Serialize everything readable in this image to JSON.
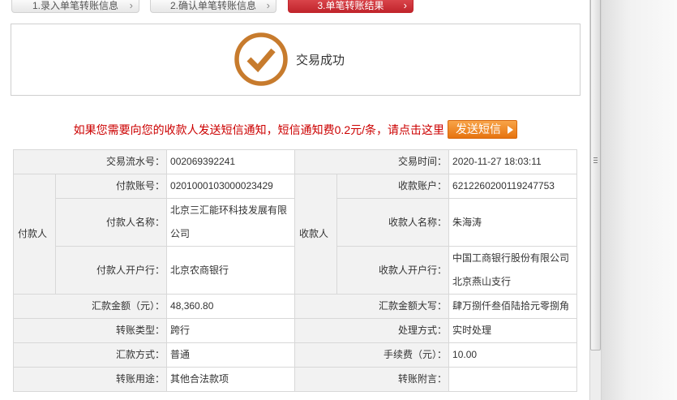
{
  "colors": {
    "active_step_bg": "#c1252c",
    "active_step_bg_light": "#d9444a",
    "success_icon": "#c77b2d",
    "notice_text": "#cc0000",
    "sms_button": "#e6730f"
  },
  "steps": [
    {
      "label": "1.录入单笔转账信息",
      "icon": "chevron-right-icon",
      "active": false
    },
    {
      "label": "2.确认单笔转账信息",
      "icon": "chevron-right-icon",
      "active": false
    },
    {
      "label": "3.单笔转账结果",
      "icon": "chevron-right-icon",
      "active": true
    }
  ],
  "result": {
    "icon": "check-circle-icon",
    "status_text": "交易成功"
  },
  "sms": {
    "notice": "如果您需要向您的收款人发送短信通知，短信通知费0.2元/条，请点击这里",
    "button_label": "发送短信",
    "button_icon": "triangle-right-icon"
  },
  "details": {
    "serial": {
      "label": "交易流水号：",
      "value": "002069392241"
    },
    "time": {
      "label": "交易时间：",
      "value": "2020-11-27 18:03:11"
    },
    "payer": {
      "group_label": "付款人",
      "account": {
        "label": "付款账号：",
        "value": "0201000103000023429"
      },
      "name": {
        "label": "付款人名称：",
        "value": "北京三汇能环科技发展有限公司"
      },
      "bank": {
        "label": "付款人开户行：",
        "value": "北京农商银行"
      }
    },
    "payee": {
      "group_label": "收款人",
      "account": {
        "label": "收款账户：",
        "value": "6212260200119247753"
      },
      "name": {
        "label": "收款人名称：",
        "value": "朱海涛"
      },
      "bank": {
        "label": "收款人开户行：",
        "value": "中国工商银行股份有限公司北京燕山支行"
      }
    },
    "amount": {
      "label": "汇款金额（元）：",
      "value": "48,360.80"
    },
    "amount_words": {
      "label": "汇款金额大写：",
      "value": "肆万捌仟叁佰陆拾元零捌角"
    },
    "transfer_type": {
      "label": "转账类型：",
      "value": "跨行"
    },
    "processing": {
      "label": "处理方式：",
      "value": "实时处理"
    },
    "remit_method": {
      "label": "汇款方式：",
      "value": "普通"
    },
    "fee": {
      "label": "手续费（元）：",
      "value": "10.00"
    },
    "purpose": {
      "label": "转账用途：",
      "value": "其他合法款项"
    },
    "memo": {
      "label": "转账附言：",
      "value": ""
    }
  }
}
